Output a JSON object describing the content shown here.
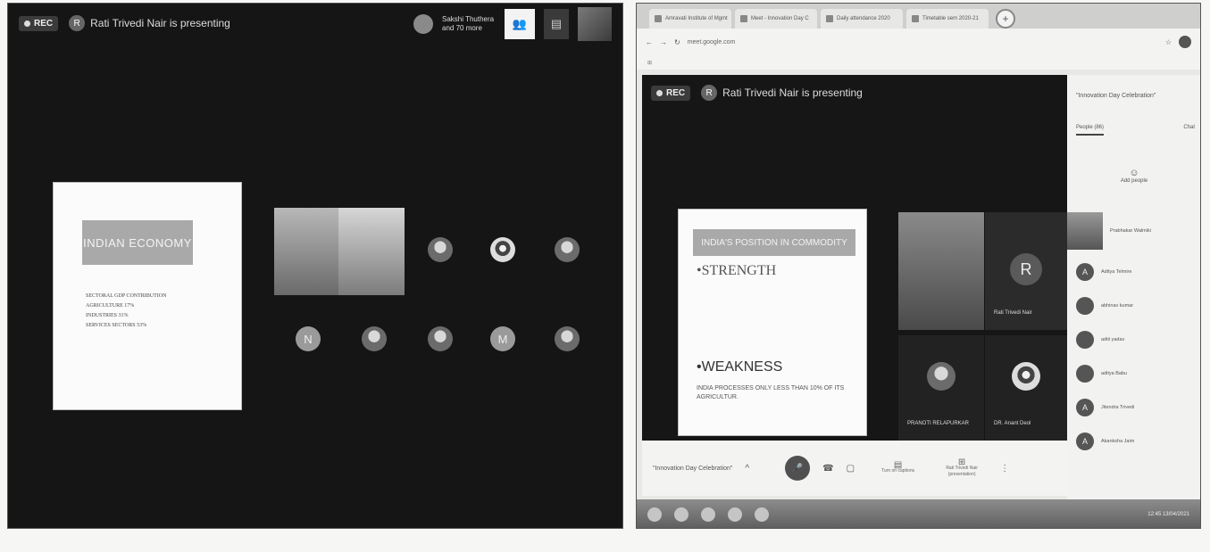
{
  "left": {
    "rec_label": "REC",
    "presenter_initial": "R",
    "presenting_text": "Rati Trivedi Nair is presenting",
    "participants_text": "Sakshi Thuthera and 70 more",
    "slide_title": "INDIAN ECONOMY",
    "slide_lines": [
      "SECTORAL GDP CONTRIBUTION",
      "AGRICULTURE 17%",
      "INDUSTRIES 31%",
      "SERVICES SECTORS 53%"
    ],
    "tiles_row2_initials": [
      "N",
      "M"
    ]
  },
  "right": {
    "tabs": [
      "Amravati Institute of Mgmt",
      "Meet - Innovation Day C",
      "Daily attendance 2020",
      "Timetable sem 2020-21"
    ],
    "url": "meet.google.com",
    "rec_label": "REC",
    "presenter_initial": "R",
    "presenting_text": "Rati Trivedi Nair is presenting",
    "slide_title": "INDIA'S POSITION IN COMMODITY",
    "strength": "STRENGTH",
    "weakness": "WEAKNESS",
    "weakness_text": "INDIA PROCESSES ONLY LESS THAN 10% OF ITS AGRICULTUR.",
    "tile_initial": "R",
    "tile_name": "Rati Trivedi Nair",
    "label_1": "PRANOTI RELAPURKAR",
    "label_2": "DR. Anant Deol",
    "meeting_name": "\"Innovation Day Celebration\"",
    "side_title": "\"Innovation Day Celebration\"",
    "people_tab": "People (86)",
    "chat_tab": "Chat",
    "add_people": "Add people",
    "people": [
      "Prabhakar Walmiki",
      "Aditya Telmire",
      "abhinav kumar",
      "aditi yadav",
      "aditya Babu",
      "Jitendra Trivedi",
      "Akanksha Jaim"
    ],
    "turn_on_captions": "Turn on captions",
    "present_now": "Rati Trivedi Nair (presentation)",
    "clock": "12:45\n13/04/2021"
  }
}
